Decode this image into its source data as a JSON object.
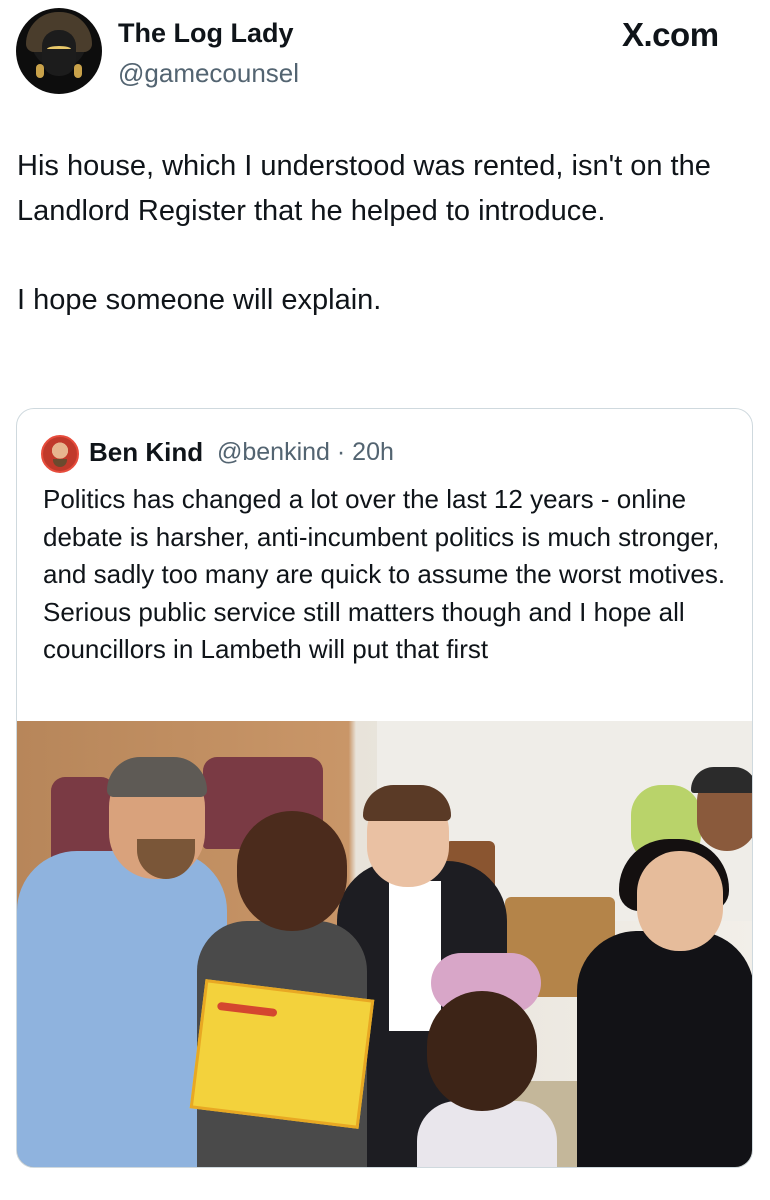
{
  "author": {
    "display_name": "The Log Lady",
    "handle": "@gamecounsel",
    "avatar_icon": "profile-avatar-icon"
  },
  "brand": "X.com",
  "tweet": {
    "paragraphs": [
      "His house, which I understood was rented, isn't on the Landlord Register that he helped to introduce.",
      "I hope someone will explain."
    ]
  },
  "quoted": {
    "display_name": "Ben Kind",
    "handle_time": "@benkind · 20h",
    "text": "Politics has changed a lot over the last 12 years - online debate is harsher, anti-incumbent politics is much stronger, and sadly too many are quick to assume the worst motives. Serious public service still matters though and I hope all councillors in Lambeth will put that first",
    "media_icon": "photo-icon"
  },
  "colors": {
    "text": "#0f1419",
    "muted": "#536471",
    "border": "#cfd9de"
  }
}
